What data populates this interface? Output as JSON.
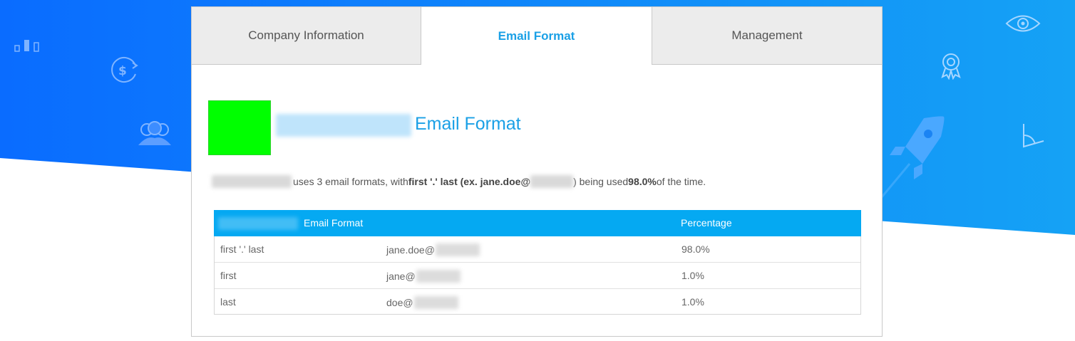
{
  "tabs": [
    {
      "label": "Company Information"
    },
    {
      "label": "Email Format"
    },
    {
      "label": "Management"
    }
  ],
  "heading": {
    "suffix": "Email Format"
  },
  "summary": {
    "part1": "uses 3 email formats, with ",
    "format_bold": "first '.' last (ex. jane.doe@",
    "part2": ") being used ",
    "percent_bold": "98.0%",
    "part3": " of the time."
  },
  "table": {
    "headers": {
      "format": "Email Format",
      "percentage": "Percentage"
    },
    "rows": [
      {
        "format": "first '.' last",
        "example": "jane.doe@",
        "percentage": "98.0%"
      },
      {
        "format": "first",
        "example": "jane@",
        "percentage": "1.0%"
      },
      {
        "format": "last",
        "example": "doe@",
        "percentage": "1.0%"
      }
    ]
  },
  "colors": {
    "hero_blue": "#0a7cff",
    "accent": "#1aa0e6",
    "table_header": "#05a9f2",
    "logo_green": "#00ff00"
  },
  "icons": [
    "bar-chart-icon",
    "dollar-refresh-icon",
    "users-icon",
    "eye-icon",
    "award-icon",
    "rocket-icon",
    "angle-icon"
  ]
}
